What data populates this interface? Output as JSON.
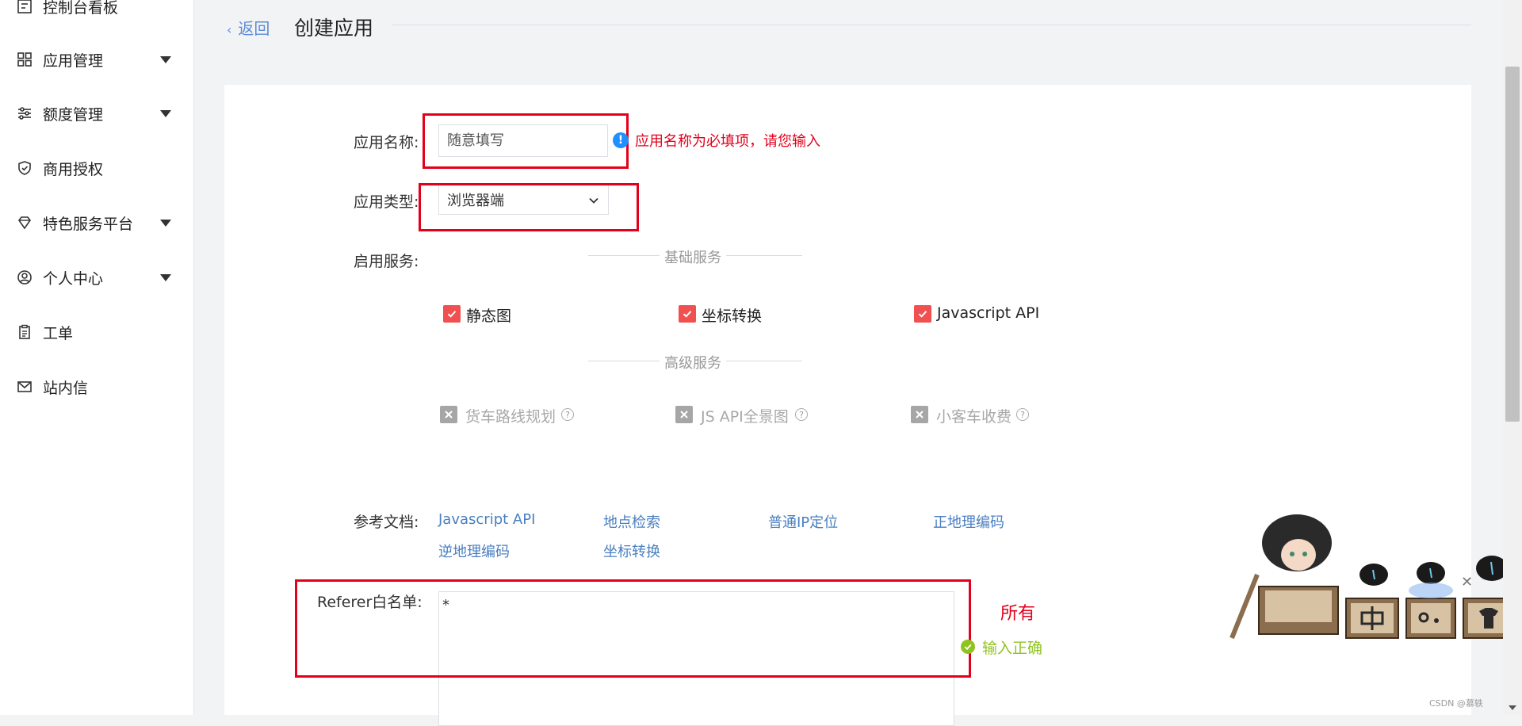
{
  "sidebar": {
    "items": [
      {
        "label": "控制台看板",
        "icon": "dashboard-icon",
        "expandable": false
      },
      {
        "label": "应用管理",
        "icon": "grid-icon",
        "expandable": true
      },
      {
        "label": "额度管理",
        "icon": "sliders-icon",
        "expandable": true
      },
      {
        "label": "商用授权",
        "icon": "shield-icon",
        "expandable": false
      },
      {
        "label": "特色服务平台",
        "icon": "diamond-icon",
        "expandable": true
      },
      {
        "label": "个人中心",
        "icon": "user-icon",
        "expandable": true
      },
      {
        "label": "工单",
        "icon": "clipboard-icon",
        "expandable": false
      },
      {
        "label": "站内信",
        "icon": "mail-icon",
        "expandable": false
      }
    ]
  },
  "header": {
    "back_label": "返回",
    "title": "创建应用"
  },
  "form": {
    "app_name": {
      "label": "应用名称:",
      "placeholder": "随意填写",
      "error": "应用名称为必填项，请您输入"
    },
    "app_type": {
      "label": "应用类型:",
      "value": "浏览器端"
    },
    "services": {
      "label": "启用服务:",
      "basic_title": "基础服务",
      "basic": [
        {
          "label": "静态图",
          "checked": true
        },
        {
          "label": "坐标转换",
          "checked": true
        },
        {
          "label": "Javascript API",
          "checked": true
        }
      ],
      "advanced_title": "高级服务",
      "advanced": [
        {
          "label": "货车路线规划",
          "checked": false
        },
        {
          "label": "JS API全景图",
          "checked": false
        },
        {
          "label": "小客车收费",
          "checked": false
        }
      ]
    },
    "docs": {
      "label": "参考文档:",
      "links": [
        "Javascript API",
        "地点检索",
        "普通IP定位",
        "正地理编码",
        "逆地理编码",
        "坐标转换"
      ]
    },
    "referer": {
      "label": "Referer白名单:",
      "value": "*",
      "annotation": "所有",
      "ok_message": "输入正确"
    }
  },
  "footer": {
    "watermark": "CSDN @慕轶"
  },
  "colors": {
    "accent_red": "#e3001b",
    "checkbox_red": "#f05050",
    "link_blue": "#4a7fc1",
    "success_green": "#8fc31f"
  }
}
